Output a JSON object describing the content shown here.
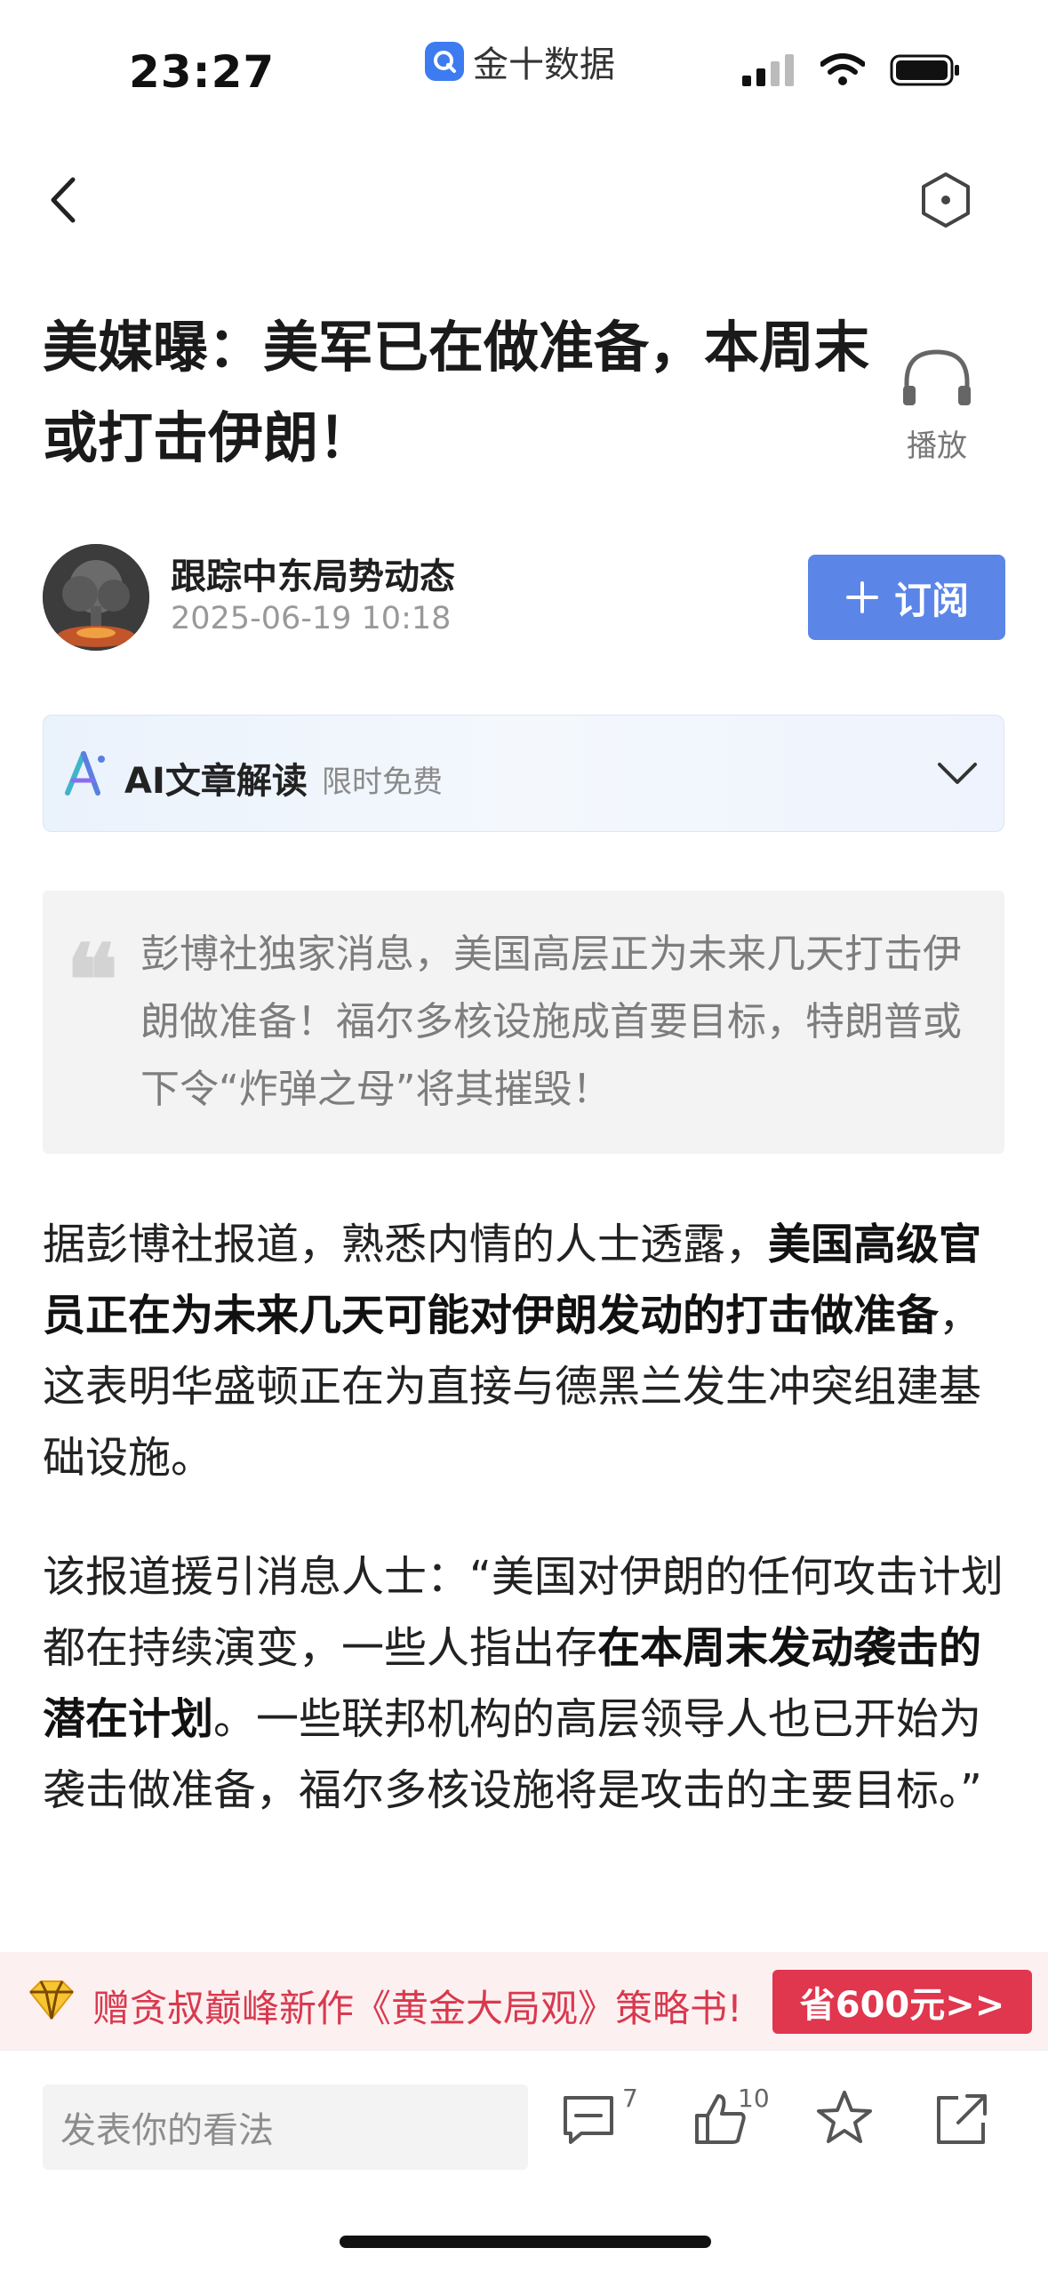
{
  "status_bar": {
    "time": "23:27",
    "app_name": "金十数据"
  },
  "nav": {
    "back_icon": "chevron-left-icon",
    "right_icon": "hexagon-icon"
  },
  "article": {
    "title": "美媒曝：美军已在做准备，本周末或打击伊朗！",
    "play_label": "播放"
  },
  "author": {
    "name": "跟踪中东局势动态",
    "date": "2025-06-19 10:18",
    "subscribe_label": "订阅"
  },
  "ai_bar": {
    "title": "AI文章解读",
    "badge": "限时免费"
  },
  "quote": {
    "mark": "❝",
    "text": "彭博社独家消息，美国高层正为未来几天打击伊朗做准备！福尔多核设施成首要目标，特朗普或下令“炸弹之母”将其摧毁！"
  },
  "body": {
    "p1_a": "据彭博社报道，熟悉内情的人士透露，",
    "p1_b": "美国高级官员正在为未来几天可能对伊朗发动的打击做准备",
    "p1_c": "，这表明华盛顿正在为直接与德黑兰发生冲突组建基础设施。",
    "p2_a": "该报道援引消息人士：“美国对伊朗的任何攻击计划都在持续演变，一些人指出存",
    "p2_b": "在本周末发动袭击的潜在计划",
    "p2_c": "。一些联邦机构的高层领导人也已开始为袭击做准备，福尔多核设施将是攻击的主要目标。”"
  },
  "promo": {
    "text": "赠贪叔巅峰新作《黄金大局观》策略书!",
    "button_label": "省600元>>"
  },
  "bottom_bar": {
    "comment_placeholder": "发表你的看法",
    "comment_count": "7",
    "like_count": "10"
  },
  "colors": {
    "accent": "#5b86e8",
    "promo_red": "#e0364e",
    "text_primary": "#1b1b1f"
  }
}
